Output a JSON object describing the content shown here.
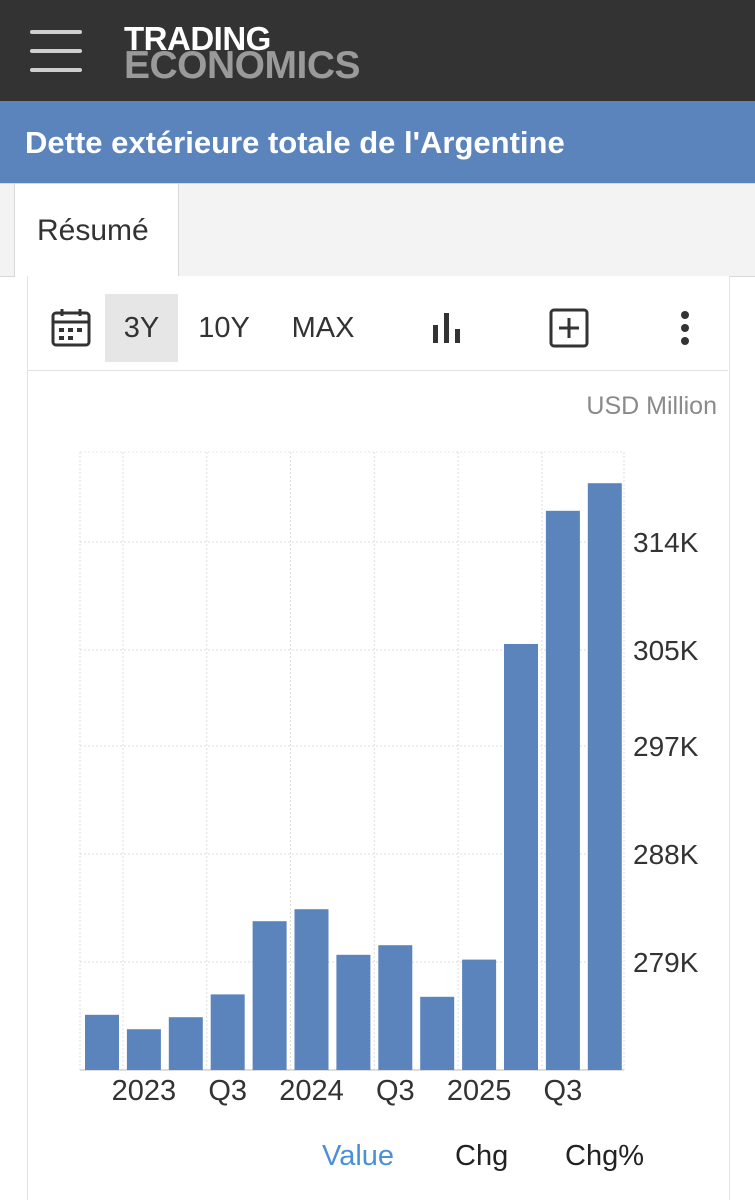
{
  "header": {
    "logo_line1": "TRADING",
    "logo_line2": "ECONOMICS",
    "page_title": "Dette extérieure totale de l'Argentine"
  },
  "tabs": [
    {
      "label": "Résumé"
    }
  ],
  "toolbar": {
    "range_3y": "3Y",
    "range_10y": "10Y",
    "range_max": "MAX",
    "selected_range": "3Y"
  },
  "chart_data": {
    "type": "bar",
    "unit": "USD Million",
    "values": [
      274600,
      273400,
      274400,
      276300,
      282400,
      283400,
      279600,
      280400,
      276100,
      279200,
      305500,
      316600,
      318900
    ],
    "x_tick_labels": [
      "2023",
      "Q3",
      "2024",
      "Q3",
      "2025",
      "Q3"
    ],
    "y_tick_labels": [
      "279K",
      "288K",
      "297K",
      "305K",
      "314K"
    ],
    "y_ticks": [
      279000,
      288000,
      297000,
      305000,
      314000
    ],
    "ylim": [
      270000,
      321500
    ],
    "grid": true,
    "bar_color": "#5b84bc"
  },
  "legend": {
    "value": "Value",
    "chg": "Chg",
    "chg_pct": "Chg%",
    "active_color": "#4a90d9"
  }
}
